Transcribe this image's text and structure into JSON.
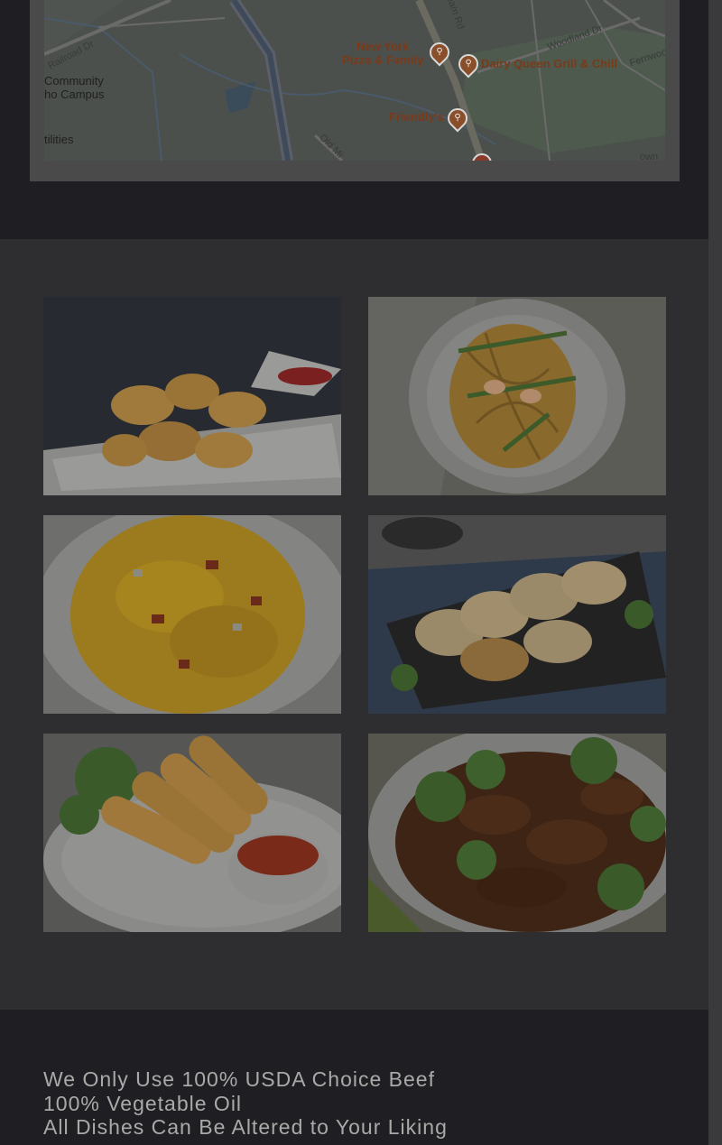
{
  "map": {
    "labels": {
      "new_york_pizza": "New York\nPizza & Family",
      "dairy_queen": "Dairy Queen Grill & Chill",
      "friendlys": "Friendly's",
      "community_campus": "Community\nho Campus",
      "railroad_dr": "Railroad Dr",
      "utilities": "tilities",
      "woodland_dr": "Woodland Dr",
      "fernwood": "Fernwoo",
      "stream_rd": "eam Rd",
      "old_mill": "Old Mi",
      "town": "own"
    },
    "pin_icon": "fork-knife-icon"
  },
  "gallery": {
    "photos": [
      {
        "alt": "Sweet and sour chicken with dipping sauce",
        "colors": {
          "bg": "#252527",
          "food": "#a07a3c"
        }
      },
      {
        "alt": "Shrimp lo mein noodles",
        "colors": {
          "bg": "#5c5c57",
          "food": "#8a6a2c"
        }
      },
      {
        "alt": "Pork fried rice",
        "colors": {
          "bg": "#6e6e6c",
          "food": "#9c7a1e"
        }
      },
      {
        "alt": "Pan-fried dumplings",
        "colors": {
          "bg": "#2e3a4a",
          "food": "#9a8a6a"
        }
      },
      {
        "alt": "Egg rolls with sweet chili sauce",
        "colors": {
          "bg": "#565654",
          "food": "#a0783c"
        }
      },
      {
        "alt": "Beef with broccoli",
        "colors": {
          "bg": "#56564e",
          "food": "#3e2414"
        }
      }
    ]
  },
  "footer": {
    "line1": "We Only Use 100% USDA Choice Beef",
    "line2": "100% Vegetable Oil",
    "line3": "All Dishes Can Be Altered to Your Liking"
  }
}
